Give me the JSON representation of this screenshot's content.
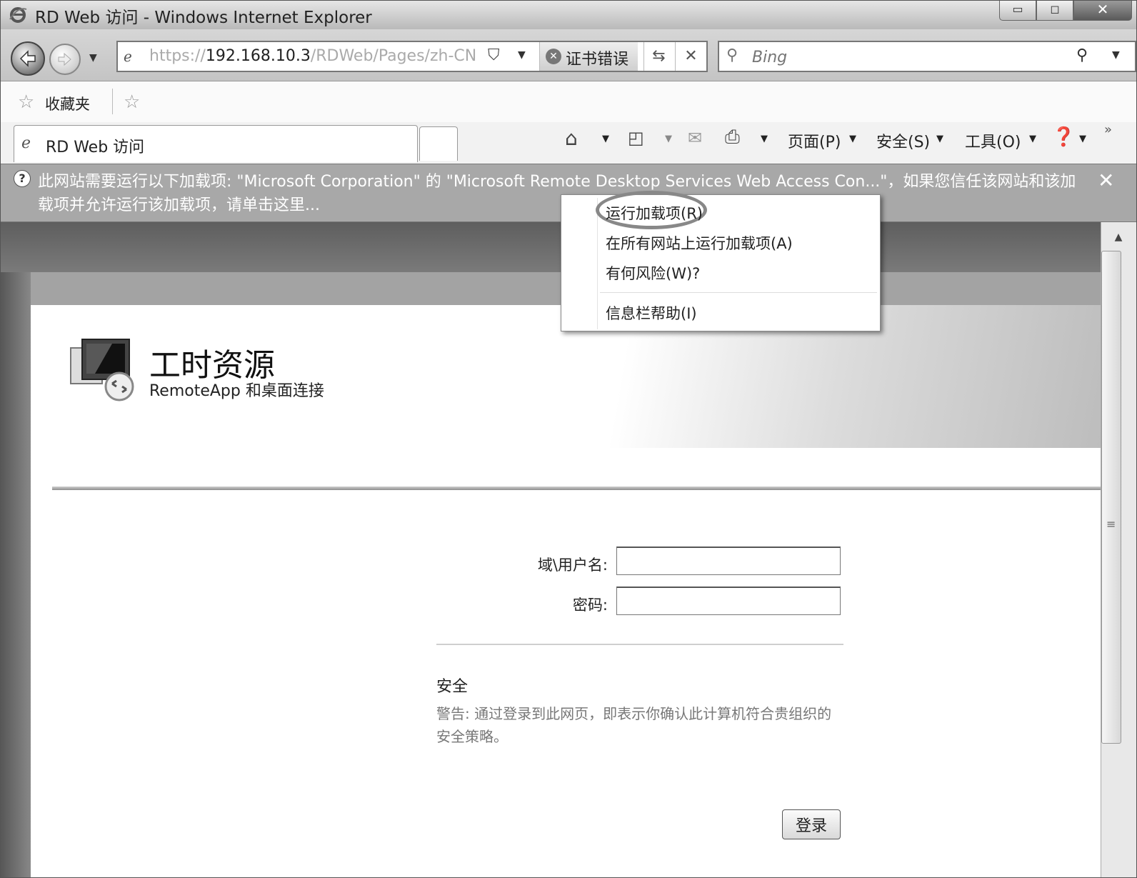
{
  "window": {
    "title": "RD Web 访问 - Windows Internet Explorer",
    "minimize": "▭",
    "maximize": "◻",
    "close": "✕"
  },
  "address_bar": {
    "url_prefix": "https://",
    "url_host": "192.168.10.3",
    "url_path": "/RDWeb/Pages/zh-CN",
    "cert_error_label": "证书错误"
  },
  "search": {
    "placeholder": "Bing"
  },
  "favorites_bar": {
    "label": "收藏夹"
  },
  "tab": {
    "label": "RD Web 访问"
  },
  "command_bar": {
    "page_menu": "页面(P)",
    "safety_menu": "安全(S)",
    "tools_menu": "工具(O)",
    "more": "»"
  },
  "info_bar": {
    "message": "此网站需要运行以下加载项: \"Microsoft Corporation\" 的 \"Microsoft Remote Desktop Services Web Access Con...\"，如果您信任该网站和该加载项并允许运行该加载项，请单击这里...",
    "close": "✕"
  },
  "context_menu": {
    "items": [
      "运行加载项(R)",
      "在所有网站上运行加载项(A)",
      "有何风险(W)?",
      "信息栏帮助(I)"
    ]
  },
  "page": {
    "title": "工时资源",
    "subtitle": "RemoteApp 和桌面连接",
    "username_label": "域\\用户名:",
    "password_label": "密码:",
    "username_value": "",
    "password_value": "",
    "security_heading": "安全",
    "security_warning": "警告: 通过登录到此网页，即表示你确认此计算机符合贵组织的安全策略。",
    "login_button": "登录"
  },
  "icons": {
    "ie": "ie-icon",
    "back": "back-arrow-icon",
    "forward": "forward-arrow-icon",
    "shield": "shield-icon",
    "refresh": "refresh-icon",
    "stop": "stop-icon",
    "search": "search-icon",
    "star": "star-icon",
    "home": "home-icon",
    "feeds": "feeds-icon",
    "mail": "mail-icon",
    "print": "print-icon",
    "help": "help-icon"
  }
}
